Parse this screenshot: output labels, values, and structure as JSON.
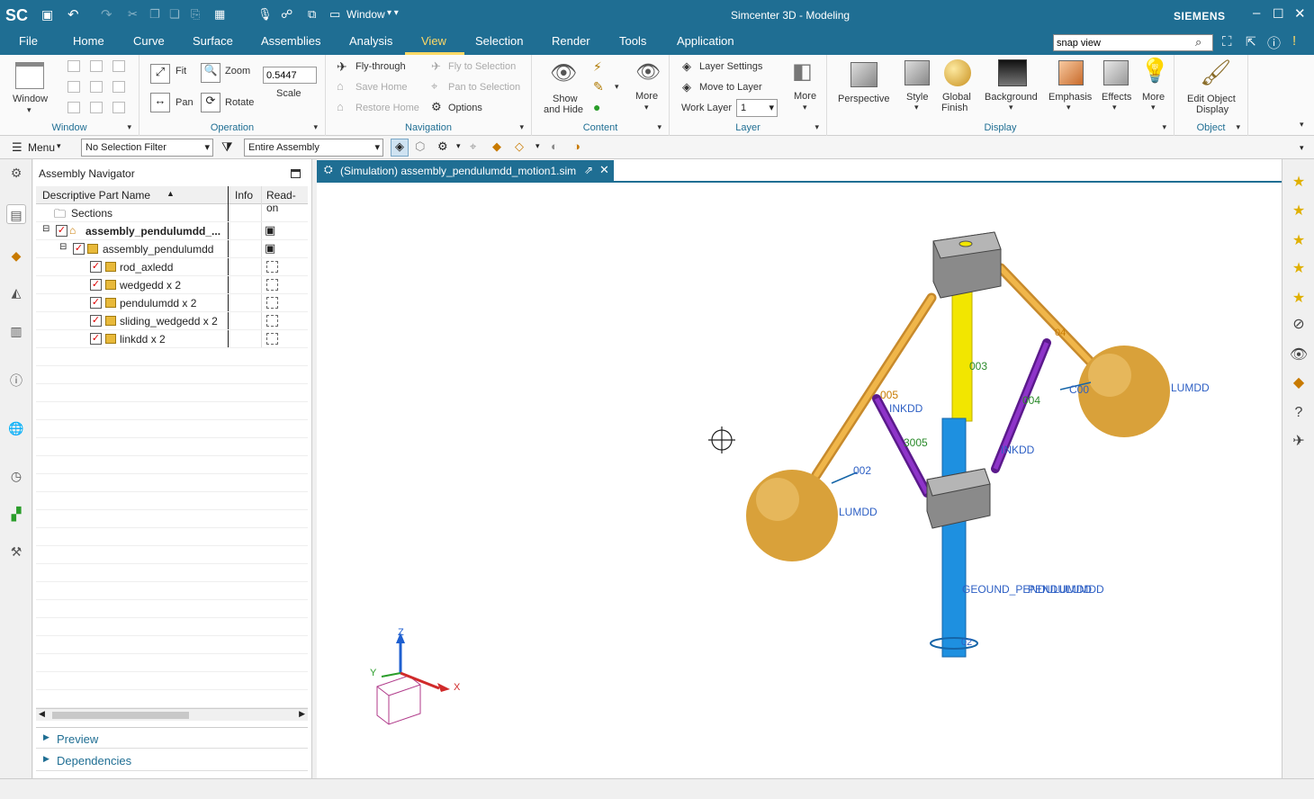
{
  "app": {
    "logo": "SC",
    "title": "Simcenter 3D - Modeling",
    "brand": "SIEMENS",
    "window_menu": "Window"
  },
  "menu": {
    "tabs": [
      "File",
      "Home",
      "Curve",
      "Surface",
      "Assemblies",
      "Analysis",
      "View",
      "Selection",
      "Render",
      "Tools",
      "Application"
    ],
    "active": "View",
    "search_value": "snap view"
  },
  "ribbon": {
    "window": {
      "label": "Window",
      "group": "Window"
    },
    "operation": {
      "fit": "Fit",
      "zoom": "Zoom",
      "pan": "Pan",
      "rotate": "Rotate",
      "scale_value": "0.5447",
      "scale_label": "Scale",
      "group": "Operation"
    },
    "navigation": {
      "fly_through": "Fly-through",
      "fly_to_selection": "Fly to Selection",
      "save_home": "Save Home",
      "pan_to_selection": "Pan to Selection",
      "restore_home": "Restore Home",
      "options": "Options",
      "group": "Navigation"
    },
    "content": {
      "show_hide_1": "Show",
      "show_hide_2": "and Hide",
      "more": "More",
      "group": "Content"
    },
    "layer": {
      "layer_settings": "Layer Settings",
      "move_to_layer": "Move to Layer",
      "work_layer": "Work Layer",
      "work_layer_value": "1",
      "more": "More",
      "group": "Layer"
    },
    "display": {
      "perspective": "Perspective",
      "style": "Style",
      "global_finish_1": "Global",
      "global_finish_2": "Finish",
      "background": "Background",
      "emphasis": "Emphasis",
      "effects": "Effects",
      "more": "More",
      "group": "Display"
    },
    "object": {
      "edit_1": "Edit Object",
      "edit_2": "Display",
      "group": "Object"
    }
  },
  "selection_bar": {
    "menu": "Menu",
    "filter": "No Selection Filter",
    "scope": "Entire Assembly"
  },
  "navigator": {
    "title": "Assembly Navigator",
    "columns": [
      "Descriptive Part Name",
      "Info",
      "Read-on"
    ],
    "rows": [
      {
        "name": "Sections",
        "indent": 0,
        "bold": false,
        "checked": false
      },
      {
        "name": "assembly_pendulumdd_...",
        "indent": 0,
        "bold": true,
        "checked": true
      },
      {
        "name": "assembly_pendulumdd",
        "indent": 1,
        "bold": false,
        "checked": true
      },
      {
        "name": "rod_axledd",
        "indent": 2,
        "bold": false,
        "checked": true
      },
      {
        "name": "wedgedd x 2",
        "indent": 2,
        "bold": false,
        "checked": true
      },
      {
        "name": "pendulumdd x 2",
        "indent": 2,
        "bold": false,
        "checked": true
      },
      {
        "name": "sliding_wedgedd x 2",
        "indent": 2,
        "bold": false,
        "checked": true
      },
      {
        "name": "linkdd x 2",
        "indent": 2,
        "bold": false,
        "checked": true
      }
    ],
    "preview": "Preview",
    "dependencies": "Dependencies"
  },
  "doc": {
    "tab_title": "(Simulation) assembly_pendulumdd_motion1.sim"
  },
  "viewport": {
    "labels": {
      "l003": "003",
      "lumdd_r": "LUMDD",
      "l005": "005",
      "linkdd_l": "INKDD",
      "g004": "004",
      "c00": "C00",
      "l3005": "3005",
      "linkdd_r": "INKDD",
      "l002": "002",
      "lumdd_l": "LUMDD",
      "rod": "PENDULUMDD",
      "ground": "GEOUND_PENDULUMDD",
      "l04": "04",
      "l02": "02"
    },
    "triad": {
      "z": "Z",
      "y": "Y",
      "x": "X"
    }
  },
  "colors": {
    "accent": "#1f6e93",
    "highlight": "#ffd966",
    "rod_yellow": "#f2e600",
    "rod_blue": "#1e90e0",
    "arm": "#e0a23a",
    "link": "#7a20b0",
    "ball": "#d8a030",
    "block": "#8a8a8a"
  }
}
